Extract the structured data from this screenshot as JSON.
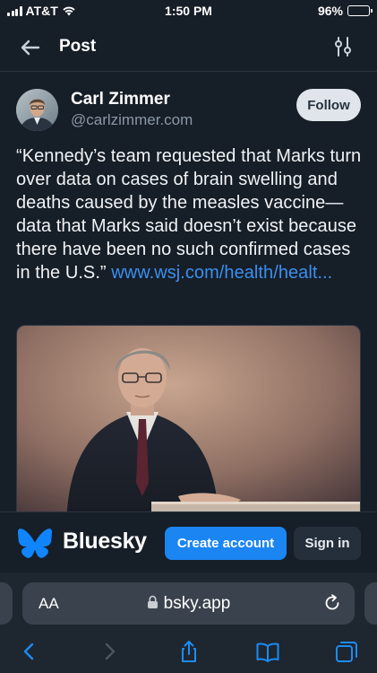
{
  "status": {
    "carrier": "AT&T",
    "time": "1:50 PM",
    "battery": "96%",
    "battery_level": 0.96
  },
  "header": {
    "title": "Post"
  },
  "post": {
    "author_name": "Carl Zimmer",
    "author_handle": "@carlzimmer.com",
    "follow_label": "Follow",
    "text": "“Kennedy’s team requested that Marks turn over data on cases of brain swelling and deaths caused by the measles vaccine—data that Marks said doesn’t exist because there have been no such confirmed cases in the U.S.” ",
    "link": "www.wsj.com/health/healt..."
  },
  "banner": {
    "brand": "Bluesky",
    "create_label": "Create account",
    "signin_label": "Sign in"
  },
  "browser": {
    "aa_label": "AA",
    "url": "bsky.app"
  },
  "colors": {
    "background": "#161e27",
    "link": "#3b8ff0",
    "primary_button": "#1b85f2",
    "brand_butterfly": "#1185fe"
  },
  "icons": {
    "back": "arrow-left-icon",
    "filter": "sliders-icon",
    "reload": "reload-icon",
    "share": "share-icon",
    "bookmarks": "book-icon",
    "tabs": "tabs-icon"
  }
}
